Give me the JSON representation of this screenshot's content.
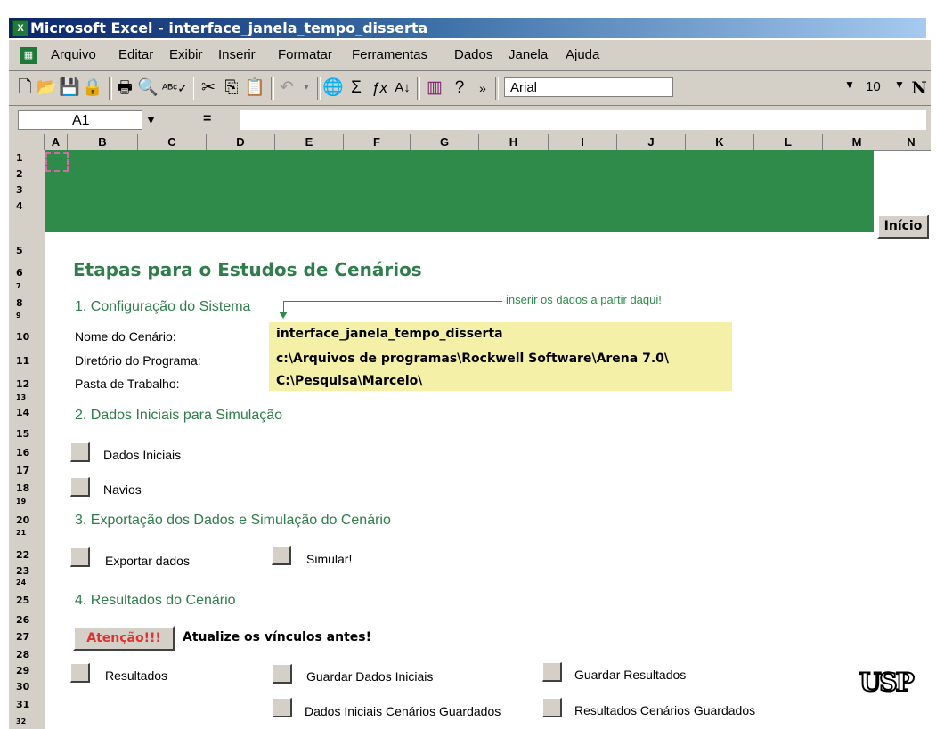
{
  "window": {
    "title": "Microsoft Excel - interface_janela_tempo_disserta"
  },
  "menu": [
    "Arquivo",
    "Editar",
    "Exibir",
    "Inserir",
    "Formatar",
    "Ferramentas",
    "Dados",
    "Janela",
    "Ajuda"
  ],
  "toolbar": {
    "font_name": "Arial",
    "font_size": "10",
    "bold": "N"
  },
  "formula_bar": {
    "cell_ref": "A1",
    "equals": "="
  },
  "columns": [
    "A",
    "B",
    "C",
    "D",
    "E",
    "F",
    "G",
    "H",
    "I",
    "J",
    "K",
    "L",
    "M",
    "N"
  ],
  "rows": [
    "1",
    "2",
    "3",
    "4",
    "5",
    "6",
    "7",
    "8",
    "9",
    "10",
    "11",
    "12",
    "13",
    "14",
    "15",
    "16",
    "17",
    "18",
    "19",
    "20",
    "21",
    "22",
    "23",
    "24",
    "25",
    "26",
    "27",
    "28",
    "29",
    "30",
    "31",
    "32"
  ],
  "sheet": {
    "inicio_label": "Início",
    "title": "Etapas para o Estudos de Cenários",
    "section1": "1. Configuração do Sistema",
    "note": "inserir os dados a partir daqui!",
    "fields": [
      {
        "label": "Nome do Cenário:",
        "value": "interface_janela_tempo_disserta"
      },
      {
        "label": "Diretório do Programa:",
        "value": "c:\\Arquivos de programas\\Rockwell Software\\Arena 7.0\\"
      },
      {
        "label": "Pasta de Trabalho:",
        "value": "C:\\Pesquisa\\Marcelo\\"
      }
    ],
    "section2": "2. Dados Iniciais para Simulação",
    "btn_dados_iniciais": "Dados Iniciais",
    "btn_navios": "Navios",
    "section3": "3. Exportação dos Dados e Simulação do Cenário",
    "btn_exportar": "Exportar dados",
    "btn_simular": "Simular!",
    "section4": "4. Resultados do Cenário",
    "atencao": "Atenção!!!",
    "atualize": "Atualize os vínculos antes!",
    "btn_resultados": "Resultados",
    "btn_guardar_dados": "Guardar Dados Iniciais",
    "btn_guardar_resultados": "Guardar Resultados",
    "btn_dados_guardados": "Dados Iniciais Cenários Guardados",
    "btn_resultados_guardados": "Resultados Cenários Guardados",
    "logo": "USP"
  },
  "colors": {
    "banner": "#2e8b4a",
    "heading": "#2e7d4a",
    "input_fill": "#f4f0a8"
  }
}
